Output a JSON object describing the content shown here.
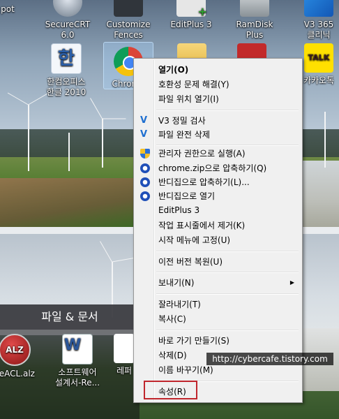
{
  "desktop": {
    "top_row_icons": [
      {
        "label": "SecureCRT\n6.0"
      },
      {
        "label": "Customize\nFences"
      },
      {
        "label": "EditPlus 3"
      },
      {
        "label": "RamDisk\nPlus"
      },
      {
        "label": "V3 365\n클리닉"
      }
    ],
    "second_row_icons": [
      {
        "label": "한컴오피스\n한글 2010"
      },
      {
        "label": "Chrome"
      },
      {
        "label": "카카오톡"
      }
    ],
    "fence": {
      "title": "파일 & 문서",
      "icons": [
        {
          "label": "ileACL.alz"
        },
        {
          "label": "소프트웨어\n설계서-Re..."
        },
        {
          "label": "레퍼"
        }
      ]
    },
    "partial_top_left": "pot"
  },
  "context_menu": {
    "items": [
      {
        "label": "열기(O)",
        "bold": true
      },
      {
        "label": "호환성 문제 해결(Y)"
      },
      {
        "label": "파일 위치 열기(I)"
      },
      {
        "label": "V3 정밀 검사",
        "icon": "v3-icon"
      },
      {
        "label": "파일 완전 삭제",
        "icon": "v3-icon"
      },
      {
        "label": "관리자 권한으로 실행(A)",
        "icon": "uac-shield-icon"
      },
      {
        "label": "chrome.zip으로 압축하기(Q)",
        "icon": "bandizip-icon"
      },
      {
        "label": "반디집으로 압축하기(L)...",
        "icon": "bandizip-icon"
      },
      {
        "label": "반디집으로 열기",
        "icon": "bandizip-icon"
      },
      {
        "label": "EditPlus 3"
      },
      {
        "label": "작업 표시줄에서 제거(K)"
      },
      {
        "label": "시작 메뉴에 고정(U)"
      },
      {
        "label": "이전 버전 복원(U)"
      },
      {
        "label": "보내기(N)",
        "submenu": true
      },
      {
        "label": "잘라내기(T)"
      },
      {
        "label": "복사(C)"
      },
      {
        "label": "바로 가기 만들기(S)"
      },
      {
        "label": "삭제(D)"
      },
      {
        "label": "이름 바꾸기(M)"
      },
      {
        "label": "속성(R)"
      }
    ],
    "submenu_arrow": "▶"
  },
  "watermark": "http://cybercafe.tistory.com",
  "colors": {
    "highlight_border": "#c0262d",
    "menu_bg": "#f0f0f0"
  }
}
